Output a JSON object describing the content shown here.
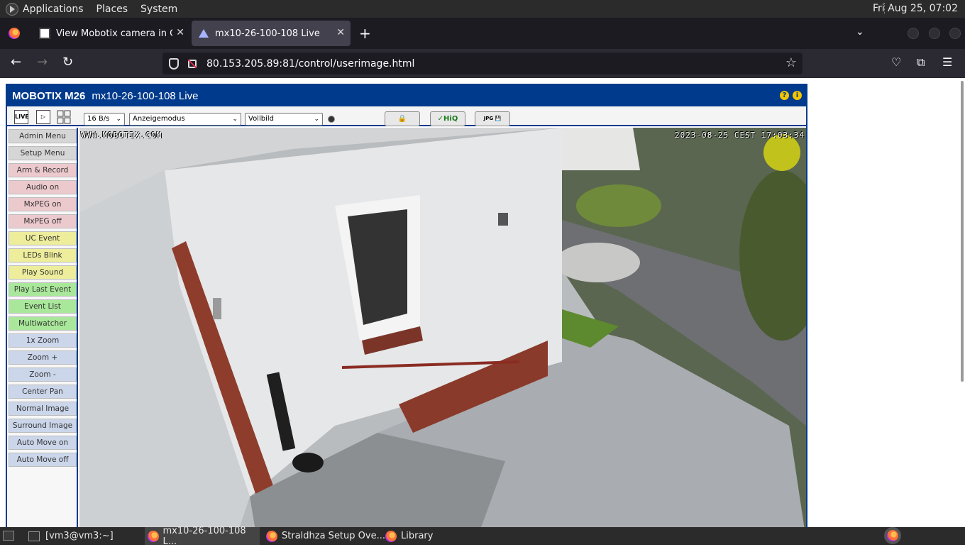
{
  "panel": {
    "menus": [
      "Applications",
      "Places",
      "System"
    ],
    "clock": "Fri Aug 25, 07:02"
  },
  "tabs": [
    {
      "title": "View Mobotix camera in Ger",
      "active": false
    },
    {
      "title": "mx10-26-100-108 Live",
      "active": true
    }
  ],
  "nav": {
    "url": "80.153.205.89:81/control/userimage.html"
  },
  "camera": {
    "brand": "MOBOTIX M26",
    "name": "mx10-26-100-108 Live",
    "toolbar": {
      "live_icon": "LIVE",
      "rate": "16 B/s",
      "mode": "Anzeigemodus",
      "view": "Vollbild",
      "hiq_label": "✓HiQ",
      "jpg_label": "JPG"
    },
    "sidebar": [
      {
        "label": "Admin Menu",
        "color": "grey"
      },
      {
        "label": "Setup Menu",
        "color": "grey"
      },
      {
        "label": "Arm & Record",
        "color": "red"
      },
      {
        "label": "Audio on",
        "color": "red"
      },
      {
        "label": "MxPEG on",
        "color": "red"
      },
      {
        "label": "MxPEG off",
        "color": "red"
      },
      {
        "label": "UC Event",
        "color": "yellow"
      },
      {
        "label": "LEDs Blink",
        "color": "yellow"
      },
      {
        "label": "Play Sound",
        "color": "yellow"
      },
      {
        "label": "Play Last Event",
        "color": "green"
      },
      {
        "label": "Event List",
        "color": "green"
      },
      {
        "label": "Multiwatcher",
        "color": "green"
      },
      {
        "label": "1x Zoom",
        "color": "blue"
      },
      {
        "label": "Zoom +",
        "color": "blue"
      },
      {
        "label": "Zoom -",
        "color": "blue"
      },
      {
        "label": "Center Pan",
        "color": "blue"
      },
      {
        "label": "Normal Image",
        "color": "blue"
      },
      {
        "label": "Surround Image",
        "color": "blue"
      },
      {
        "label": "Auto Move on",
        "color": "blue"
      },
      {
        "label": "Auto Move off",
        "color": "blue"
      }
    ],
    "overlay": {
      "left": "WWW.MOBOTIX.COM",
      "right": "2023-08-25 CEST 17:03:34"
    }
  },
  "taskbar": [
    {
      "label": "[vm3@vm3:~]",
      "icon": "terminal-icon"
    },
    {
      "label": "mx10-26-100-108 L...",
      "icon": "firefox-icon",
      "active": true
    },
    {
      "label": "Straldhza Setup Ove...",
      "icon": "firefox-icon"
    },
    {
      "label": "Library",
      "icon": "firefox-icon"
    }
  ],
  "colors": {
    "mobotix_blue": "#003a8c",
    "grey": "#d6d6d6",
    "red": "#ecc9cd",
    "yellow": "#eded9c",
    "green": "#a9e89a",
    "blue": "#cbd6ea"
  }
}
